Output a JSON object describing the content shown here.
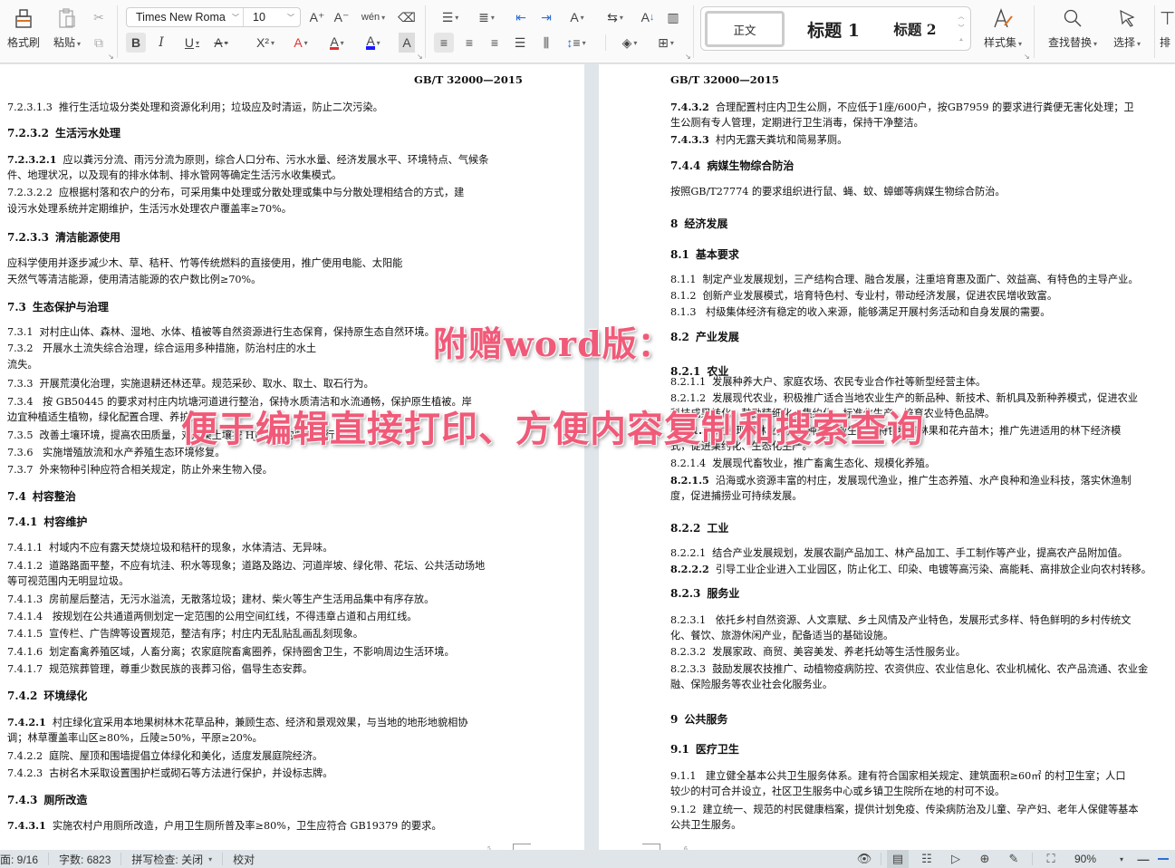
{
  "ribbon": {
    "format_painter": "格式刷",
    "paste": "粘贴",
    "font_name": "Times New Roma",
    "font_size": "10",
    "styles": {
      "normal": "正文",
      "heading1": "标题 1",
      "heading2": "标题 2"
    },
    "style_set": "样式集",
    "find_replace": "查找替换",
    "select": "选择",
    "arrange": "排",
    "icons": {
      "bold": "B",
      "italic": "I",
      "underline": "U",
      "strike": "A",
      "superscript": "X²",
      "text_effect": "A",
      "highlight": "A",
      "font_color": "A",
      "char_shading": "A",
      "grow_font": "A⁺",
      "shrink_font": "A⁻",
      "pinyin": "wén",
      "clear_format": "⌫"
    },
    "font_color_hex": "#1a1aff",
    "highlight_hex": "#e03030"
  },
  "watermark": {
    "line1": "附赠word版：",
    "line2": "便于编辑直接打印、方便内容复制和搜索查询",
    "color": "#f05a78"
  },
  "left_page": {
    "header": "GB/T  32000—2015",
    "page_number": "5",
    "paragraphs": [
      {
        "num": "7.2.3.1.3",
        "text": "推行生活垃圾分类处理和资源化利用；垃圾应及时清运，防止二次污染。",
        "bold": false
      },
      {
        "num": "7.2.3.2",
        "text": "生活污水处理",
        "heading": true
      },
      {
        "num": "7.2.3.2.1",
        "text": "应以粪污分流、雨污分流为原则，综合人口分布、污水水量、经济发展水平、环境特点、气候条",
        "bold_num": true
      },
      {
        "num": "",
        "text": "件、地理状况，以及现有的排水体制、排水管网等确定生活污水收集模式。"
      },
      {
        "num": "7.2.3.2.2",
        "text": "应根据村落和农户的分布，可采用集中处理或分散处理或集中与分散处理相结合的方式，建"
      },
      {
        "num": "",
        "text": "设污水处理系统并定期维护，生活污水处理农户覆盖率≥70%。"
      },
      {
        "num": "7.2.3.3",
        "text": "清洁能源使用",
        "heading": true
      },
      {
        "num": "",
        "text": "      应科学使用并逐步减少木、草、秸秆、竹等传统燃料的直接使用，推广使用电能、太阳能"
      },
      {
        "num": "",
        "text": "天然气等清洁能源，使用清洁能源的农户数比例≥70%。"
      },
      {
        "num": "7.3",
        "text": "生态保护与治理",
        "heading": true
      },
      {
        "num": "7.3.1",
        "text": "对村庄山体、森林、湿地、水体、植被等自然资源进行生态保育，保持原生态自然环境。"
      },
      {
        "num": "7.3.2",
        "text": " 开展水土流失综合治理，综合运用多种措施，防治村庄的水土"
      },
      {
        "num": "",
        "text": "流失。"
      },
      {
        "num": "7.3.3",
        "text": "开展荒漠化治理，实施退耕还林还草。规范采砂、取水、取土、取石行为。"
      },
      {
        "num": "7.3.4",
        "text": " 按 GB50445  的要求对村庄内坑塘河道进行整治，保持水质清洁和水流通畅，保护原生植被。岸"
      },
      {
        "num": "",
        "text": "边宜种植适生植物，绿化配置合理、养护到位。"
      },
      {
        "num": "7.3.5",
        "text": "改善土壤环境，提高农田质量，对污染土壤按 HJ25.4  的要求进行修复。"
      },
      {
        "num": "7.3.6",
        "text": " 实施增殖放流和水产养殖生态环境修复。"
      },
      {
        "num": "7.3.7",
        "text": "外来物种引种应符合相关规定，防止外来生物入侵。"
      },
      {
        "num": "7.4",
        "text": "村容整治",
        "heading": true
      },
      {
        "num": "7.4.1",
        "text": "村容维护",
        "heading": true
      },
      {
        "num": "7.4.1.1",
        "text": "村域内不应有露天焚烧垃圾和秸秆的现象，水体清洁、无异味。"
      },
      {
        "num": "7.4.1.2",
        "text": "道路路面平整，不应有坑洼、积水等现象；道路及路边、河道岸坡、绿化带、花坛、公共活动场地"
      },
      {
        "num": "",
        "text": "等可视范围内无明显垃圾。"
      },
      {
        "num": "7.4.1.3",
        "text": "房前屋后整洁，无污水溢流，无散落垃圾；建材、柴火等生产生活用品集中有序存放。"
      },
      {
        "num": "7.4.1.4",
        "text": " 按规划在公共通道两侧划定一定范围的公用空间红线，不得违章占道和占用红线。"
      },
      {
        "num": "7.4.1.5",
        "text": "宣传栏、广告牌等设置规范，整洁有序；村庄内无乱贴乱画乱刻现象。"
      },
      {
        "num": "7.4.1.6",
        "text": "划定畜禽养殖区域，人畜分离；农家庭院畜禽圈养，保持圈舍卫生，不影响周边生活环境。"
      },
      {
        "num": "7.4.1.7",
        "text": "规范殡葬管理，尊重少数民族的丧葬习俗，倡导生态安葬。"
      },
      {
        "num": "7.4.2",
        "text": "环境绿化",
        "heading": true
      },
      {
        "num": "7.4.2.1",
        "text": "村庄绿化宜采用本地果树林木花草品种，兼顾生态、经济和景观效果，与当地的地形地貌相协",
        "bold_num": true
      },
      {
        "num": "",
        "text": "调；林草覆盖率山区≥80%，丘陵≥50%，平原≥20%。"
      },
      {
        "num": "7.4.2.2",
        "text": "庭院、屋顶和围墙提倡立体绿化和美化，适度发展庭院经济。"
      },
      {
        "num": "7.4.2.3",
        "text": "古树名木采取设置围护栏或砌石等方法进行保护，并设标志牌。"
      },
      {
        "num": "7.4.3",
        "text": "厕所改造",
        "heading": true
      },
      {
        "num": "7.4.3.1",
        "text": "实施农村户用厕所改造，户用卫生厕所普及率≥80%，卫生应符合 GB19379  的要求。",
        "bold_num": true
      }
    ]
  },
  "right_page": {
    "header": "GB/T  32000—2015",
    "page_number": "6",
    "paragraphs": [
      {
        "num": "7.4.3.2",
        "text": "合理配置村庄内卫生公厕，不应低于1座/600户，按GB7959  的要求进行粪便无害化处理；卫",
        "bold_num": true
      },
      {
        "num": "",
        "text": "生公厕有专人管理，定期进行卫生消毒，保持干净整洁。"
      },
      {
        "num": "7.4.3.3",
        "text": "村内无露天粪坑和简易茅厕。",
        "bold_num": true
      },
      {
        "num": "7.4.4",
        "text": "病媒生物综合防治",
        "heading": true
      },
      {
        "num": "",
        "text": "      按照GB/T27774  的要求组织进行鼠、蝇、蚊、蟑螂等病媒生物综合防治。"
      },
      {
        "num": "8",
        "text": "经济发展",
        "heading": true
      },
      {
        "num": "8.1",
        "text": "基本要求",
        "heading": true
      },
      {
        "num": "8.1.1",
        "text": "制定产业发展规划，三产结构合理、融合发展，注重培育惠及面广、效益高、有特色的主导产业。"
      },
      {
        "num": "8.1.2",
        "text": "创新产业发展模式，培育特色村、专业村，带动经济发展，促进农民增收致富。"
      },
      {
        "num": "8.1.3",
        "text": " 村级集体经济有稳定的收入来源，能够满足开展村务活动和自身发展的需要。"
      },
      {
        "num": "8.2",
        "text": "产业发展",
        "heading": true
      },
      {
        "num": "8.2.1",
        "text": "农业",
        "heading": true
      },
      {
        "num": "8.2.1.1",
        "text": "发展种养大户、家庭农场、农民专业合作社等新型经营主体。"
      },
      {
        "num": "8.2.1.2",
        "text": "发展现代农业，积极推广适合当地农业生产的新品种、新技术、新机具及新种养模式，促进农业"
      },
      {
        "num": "",
        "text": "科技成果转化；鼓励精细化、集约化、标准化生产，培育农业特色品牌。"
      },
      {
        "num": "8.2.1.3",
        "text": "发展现代林业，提倡种植高效生态的特色经济林果和花卉苗木；推广先进适用的林下经济模",
        "bold_num": true
      },
      {
        "num": "",
        "text": "式，促进集约化、生态化生产。"
      },
      {
        "num": "8.2.1.4",
        "text": "发展现代畜牧业，推广畜禽生态化、规模化养殖。"
      },
      {
        "num": "8.2.1.5",
        "text": "沿海或水资源丰富的村庄，发展现代渔业，推广生态养殖、水产良种和渔业科技，落实休渔制",
        "bold_num": true
      },
      {
        "num": "",
        "text": "度，促进捕捞业可持续发展。"
      },
      {
        "num": "8.2.2",
        "text": "工业",
        "heading": true
      },
      {
        "num": "8.2.2.1",
        "text": "结合产业发展规划，发展农副产品加工、林产品加工、手工制作等产业，提高农产品附加值。"
      },
      {
        "num": "8.2.2.2",
        "text": "引导工业企业进入工业园区，防止化工、印染、电镀等高污染、高能耗、高排放企业向农村转移。",
        "bold_num": true
      },
      {
        "num": "8.2.3",
        "text": "服务业",
        "heading": true
      },
      {
        "num": "8.2.3.1",
        "text": " 依托乡村自然资源、人文禀赋、乡土风情及产业特色，发展形式多样、特色鲜明的乡村传统文"
      },
      {
        "num": "",
        "text": "化、餐饮、旅游休闲产业，配备适当的基础设施。"
      },
      {
        "num": "8.2.3.2",
        "text": "发展家政、商贸、美容美发、养老托幼等生活性服务业。"
      },
      {
        "num": "8.2.3.3",
        "text": "鼓励发展农技推广、动植物疫病防控、农资供应、农业信息化、农业机械化、农产品流通、农业金"
      },
      {
        "num": "",
        "text": "融、保险服务等农业社会化服务业。"
      },
      {
        "num": "9",
        "text": "公共服务",
        "heading": true
      },
      {
        "num": "9.1",
        "text": "医疗卫生",
        "heading": true
      },
      {
        "num": "9.1.1",
        "text": " 建立健全基本公共卫生服务体系。建有符合国家相关规定、建筑面积≥60㎡ 的村卫生室；人口"
      },
      {
        "num": "",
        "text": "较少的村可合并设立，社区卫生服务中心或乡镇卫生院所在地的村可不设。"
      },
      {
        "num": "9.1.2",
        "text": "建立统一、规范的村民健康档案，提供计划免疫、传染病防治及儿童、孕产妇、老年人保健等基本"
      },
      {
        "num": "",
        "text": "公共卫生服务。"
      }
    ]
  },
  "statusbar": {
    "page": "面: 9/16",
    "word_count": "字数: 6823",
    "spell_check": "拼写检查: 关闭",
    "proofread": "校对",
    "zoom": "90%"
  }
}
